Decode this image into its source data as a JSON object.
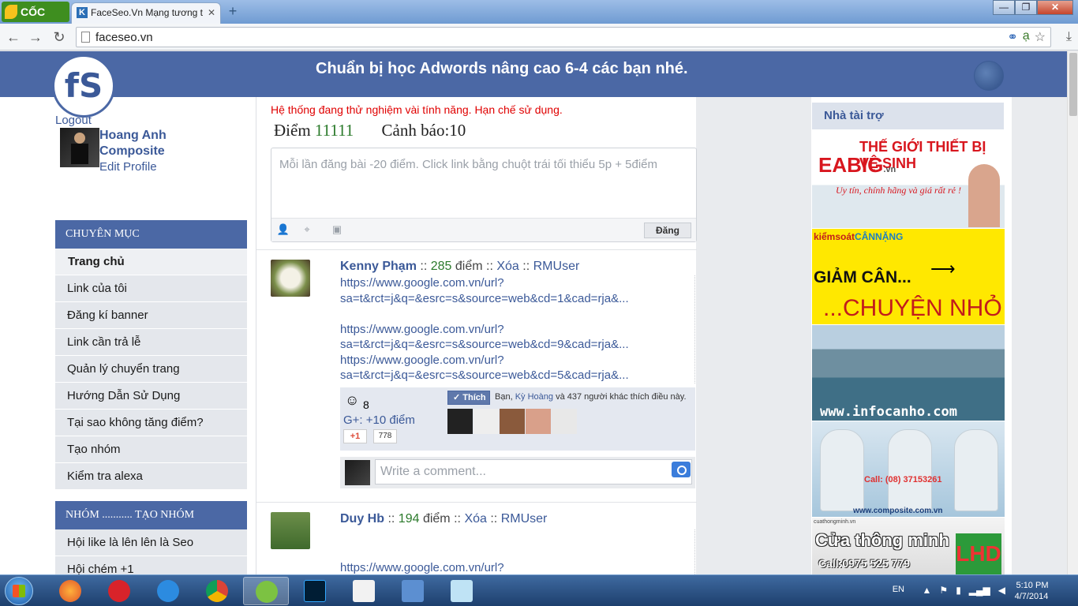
{
  "browser": {
    "brand": "CỐC CỐC",
    "tab_title": "FaceSeo.Vn Mạng tương t",
    "url": "faceseo.vn",
    "new_tab_symbol": "+",
    "tab_close_symbol": "✕",
    "min_symbol": "—",
    "max_symbol": "❐",
    "close_symbol": "✕"
  },
  "banner": {
    "logo": "fS",
    "text": "Chuẩn bị học Adwords nâng cao 6-4 các bạn nhé."
  },
  "user": {
    "logout": "Logout",
    "name": "Hoang Anh Composite",
    "edit_profile": "Edit Profile"
  },
  "menu": {
    "header": "CHUYÊN MỤC",
    "items": [
      "Trang chủ",
      "Link của tôi",
      "Đăng kí banner",
      "Link cần trả lễ",
      "Quản lý chuyển trang",
      "Hướng Dẫn Sử Dụng",
      "Tại sao không tăng điểm?",
      "Tạo nhóm",
      "Kiểm tra alexa"
    ]
  },
  "groups": {
    "header": "NHÓM ........... TẠO NHÓM",
    "items": [
      "Hội like là lên lên là Seo",
      "Hội chém +1"
    ]
  },
  "main": {
    "notice": "Hệ thống đang thử nghiệm vài tính năng. Hạn chế sử dụng.",
    "points_label": "Điểm",
    "points_value": "11111",
    "warning_label": "Cảnh báo:",
    "warning_value": "10",
    "composer_placeholder": "Mỗi lần đăng bài -20 điểm. Click link bằng chuột trái tối thiểu 5p  + 5điểm",
    "post_button": "Đăng"
  },
  "posts": [
    {
      "author": "Kenny Phạm",
      "sep": "::",
      "score": "285",
      "score_unit": "điểm",
      "delete": "Xóa",
      "rmuser": "RMUser",
      "links": [
        "https://www.google.com.vn/url?",
        "sa=t&rct=j&q=&esrc=s&source=web&cd=1&cad=rja&...",
        "",
        "https://www.google.com.vn/url?",
        "sa=t&rct=j&q=&esrc=s&source=web&cd=9&cad=rja&...",
        "https://www.google.com.vn/url?",
        "sa=t&rct=j&q=&esrc=s&source=web&cd=5&cad=rja&..."
      ],
      "likes": "8",
      "gplus_text": "G+: +10 điểm",
      "gplus_button": "+1",
      "gplus_count": "778",
      "fb_like_button": "Thích",
      "fb_like_prefix": "Bạn,",
      "fb_like_name": "Kỳ Hoàng",
      "fb_like_suffix": "và 437 người khác thích điều này.",
      "comment_placeholder": "Write a comment..."
    },
    {
      "author": "Duy Hb",
      "sep": "::",
      "score": "194",
      "score_unit": "điểm",
      "delete": "Xóa",
      "rmuser": "RMUser",
      "links": [
        "",
        "",
        "https://www.google.com.vn/url?"
      ]
    }
  ],
  "sponsors": {
    "header": "Nhà tài trợ",
    "ad1": {
      "title": "THẾ GIỚI THIẾT BỊ VỆ SINH",
      "brand": "EABIG",
      "tld": ".vn",
      "slogan": "Uy tín, chính hãng và giá rất rẻ !"
    },
    "ad2": {
      "brand_a": "kiểmsoát",
      "brand_b": "CÂNNẶNG",
      "line1": "GIẢM CÂN...",
      "line2": "...CHUYỆN NHỎ"
    },
    "ad3": {
      "site": "www.infocanho.com"
    },
    "ad4": {
      "call": "Call: (08) 37153261",
      "site": "www.composite.com.vn"
    },
    "ad5": {
      "tiny": "cuathongminh.vn",
      "title": "Cửa thông minh",
      "phone": "Call:0975 525 779",
      "logo": "LHD"
    }
  },
  "taskbar": {
    "lang": "EN",
    "time": "5:10 PM",
    "date": "4/7/2014"
  }
}
